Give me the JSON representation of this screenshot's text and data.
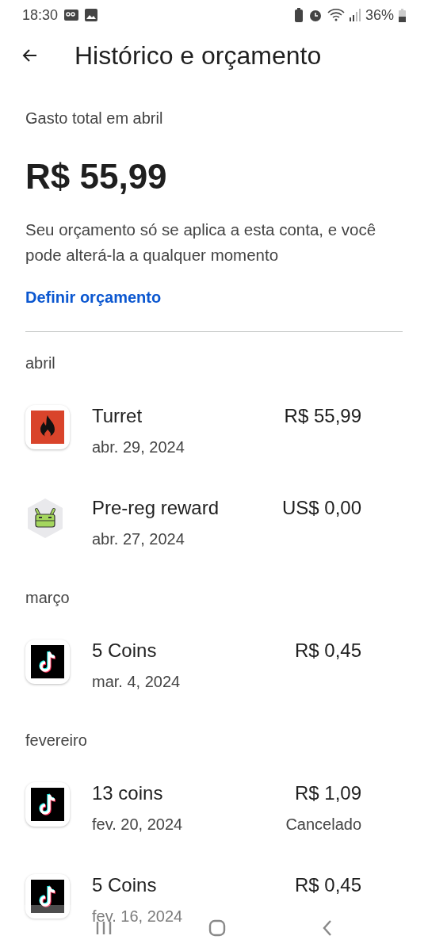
{
  "status_bar": {
    "time": "18:30",
    "battery": "36%"
  },
  "header": {
    "title": "Histórico e orçamento"
  },
  "summary": {
    "label": "Gasto total em abril",
    "amount": "R$ 55,99",
    "note": "Seu orçamento só se aplica a esta conta, e você pode alterá-la a qualquer momento",
    "link": "Definir orçamento"
  },
  "sections": [
    {
      "month": "abril",
      "items": [
        {
          "kind": "fire",
          "name": "Turret",
          "date": "abr. 29, 2024",
          "amount": "R$ 55,99"
        },
        {
          "kind": "android",
          "name": "Pre-reg reward",
          "date": "abr. 27, 2024",
          "amount": "US$ 0,00"
        }
      ]
    },
    {
      "month": "março",
      "items": [
        {
          "kind": "tiktok",
          "name": "5 Coins",
          "date": "mar. 4, 2024",
          "amount": "R$ 0,45"
        }
      ]
    },
    {
      "month": "fevereiro",
      "items": [
        {
          "kind": "tiktok",
          "name": "13 coins",
          "date": "fev. 20, 2024",
          "amount": "R$ 1,09",
          "status": "Cancelado"
        },
        {
          "kind": "tiktok",
          "name": "5 Coins",
          "date": "fev. 16, 2024",
          "amount": "R$ 0,45"
        }
      ]
    }
  ]
}
